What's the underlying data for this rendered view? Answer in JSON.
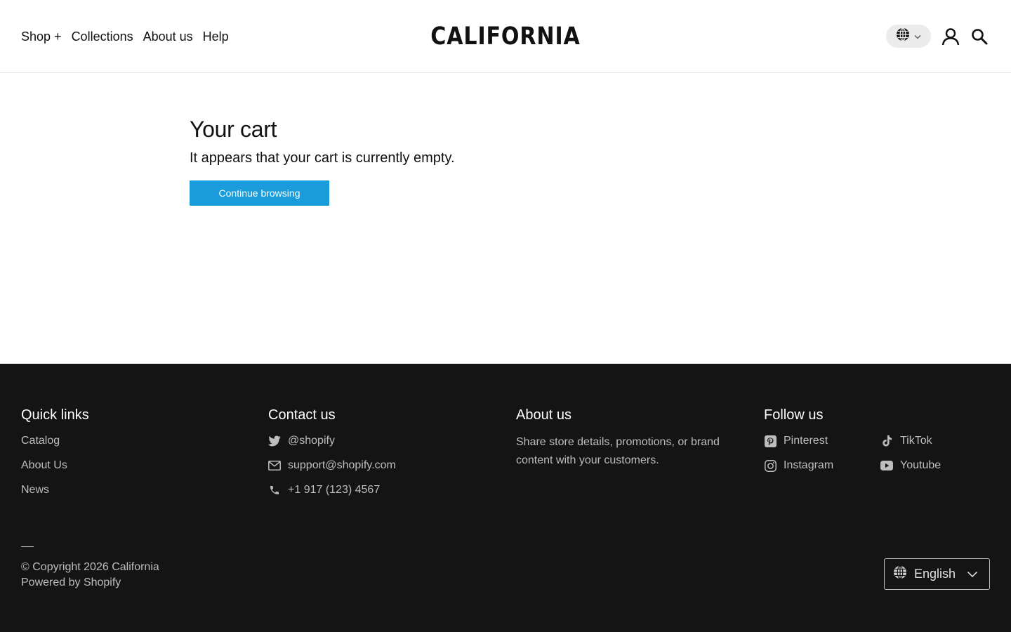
{
  "header": {
    "nav": [
      {
        "label": "Shop +"
      },
      {
        "label": "Collections"
      },
      {
        "label": "About us"
      },
      {
        "label": "Help"
      }
    ],
    "logo": "CALIFORNIA"
  },
  "cart": {
    "title": "Your cart",
    "empty_message": "It appears that your cart is currently empty.",
    "continue_label": "Continue browsing"
  },
  "footer": {
    "quick_links": {
      "heading": "Quick links",
      "items": [
        "Catalog",
        "About Us",
        "News"
      ]
    },
    "contact": {
      "heading": "Contact us",
      "twitter": "@shopify",
      "email": "support@shopify.com",
      "phone": "+1 917 (123) 4567"
    },
    "about": {
      "heading": "About us",
      "text": "Share store details, promotions, or brand content with your customers."
    },
    "follow": {
      "heading": "Follow us",
      "items": [
        "Pinterest",
        "TikTok",
        "Instagram",
        "Youtube"
      ]
    },
    "copyright": "© Copyright 2026 California",
    "powered": "Powered by Shopify",
    "language": "English"
  },
  "colors": {
    "accent": "#1a9cdb",
    "footer_bg": "#141414"
  }
}
